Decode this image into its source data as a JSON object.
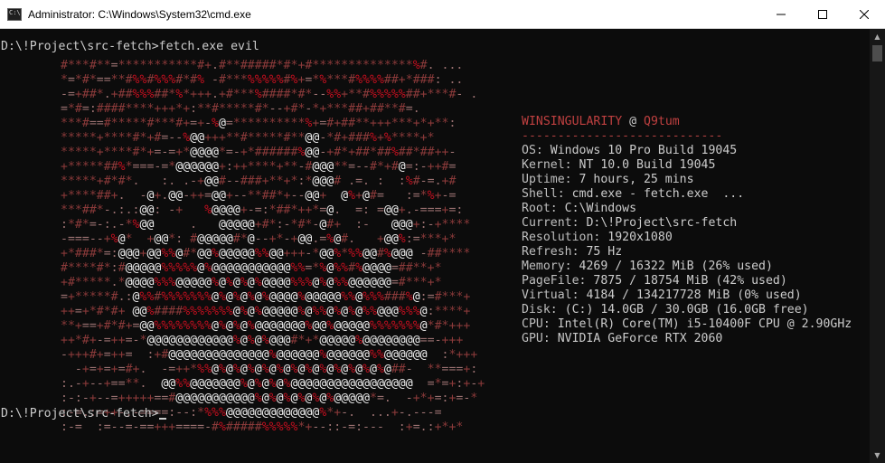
{
  "window": {
    "title": "Administrator: C:\\Windows\\System32\\cmd.exe",
    "icon": "cmd-icon"
  },
  "console": {
    "command_line": "D:\\!Project\\src-fetch>fetch.exe evil",
    "bottom_prompt": "D:\\!Project\\src-fetch>",
    "ascii_art": [
      "#***#**=***********#+.#**#####*#*+#**************%#. ...",
      "*=*#*==**#%%#%%%#*#% -#***%%%%%#%+=*%***#%%%%##+*###: ..",
      "-=+##*.+##%%%##*%*+++.+#***%####*#*--%%+**#%%%%%##+***#- .",
      "=*#=:####****+++*+:**#*****#*--+#*-*+***##+##**#=.",
      "***#==#*****#***#+=+-%@=**********%+=#+##**+++***+*+**:",
      "*****+****#*+#=--%@@+++**#*****#**@@-*#+###%+%****+*",
      "*****+****#*+=-=+*@@@@*=-+*######%@@-+#*+##*##%##*##++-",
      "+*****##%*===-=*@@@@@@+:++****+**-#@@@**=--#*+#@=:-++#=",
      "*****+#*#*.   :. .-+@@#--###+**+*:*@@@# .=. :  :%#-=.+#",
      "+****##+.  -@+.@@-++=@@+--**##*+--@@+  @%+@#=   :=*%+-=",
      "***##*-.:.:@@: -+   %@@@@+-=:*##*++*=@.  =: =@@+.-===+=:",
      ":*#*=-:.-*%@@     .   @@@@@+#*:-*#*-@#+  :-   @@@+:-+****",
      "-===--+%@*  +@@*: #@@@@@#*@--+*-+@@.=%@#.   +@@%:=***+*",
      "+*###*=:@@@+@@%%@#*@@%@@@@@%%@@+++-*@@%*%%@@#%@@@ -##****",
      "#****#*:#@@@@@%%%%%@%@@@@@@@@@@@%%=*%@%%#%@@@@=##**+*",
      "+#*****.*@@@@%%%@@@@@%@%@%@%@@@@%%%@%@%%@@@@@@=#***+*",
      "=+*****#.:@%%#%%%%%%%@%@%@%@%@@@@%@@@@@%%@%%%###%@:=#***+",
      "++=+*#*#+ @@%####%%%%%%%@%@%@@@@@%@%%@%@%@%%@@@%%%@:****+",
      "**+==+#*#+=@@%%%%%%%%@%@%@%@@@@@@@%@@%@@@@@%%%%%%%@*#*+++",
      "++*#+-=++=-*@@@@@@@@@@@@%@%@%@@@#*+*@@@@@%@@@@@@@@==-+++",
      "-+++#+=++=  :+#@@@@@@@@@@@@@@%@@@@@@%@@@@@@%%@@@@@@  :*+++",
      "  -+=+=+=#+.  -=++*%%@%@%@%@%@%@%@%@%@%@%@%@%@##-  **===+:",
      ":.-+--+==**.  @@%%@@@@@@@%@%@%@%@@@@@@@@@@@@@@@@@  =*=+:+-+",
      ":-:-+--=+++++==#@@@@@@@@@@@%@%@%@%@%@%@@@@@*=.  -+*+=:+=-*",
      ":-=.:=++-.-====:--:*%%%@@@@@@@@@@@@@%*+-.  ...+-.---=",
      ":-=  :=--=-==+++====-#%#####%%%%%*+--::-=:---  :+=.:+*+*"
    ],
    "sysinfo": {
      "user": "WINSINGULARITY",
      "at": "@",
      "host": "Q9tum",
      "separator": "----------------------------",
      "items": [
        {
          "label": "OS:",
          "value": "Windows 10 Pro Build 19045"
        },
        {
          "label": "Kernel:",
          "value": "NT 10.0 Build 19045"
        },
        {
          "label": "Uptime:",
          "value": "7 hours, 25 mins"
        },
        {
          "label": "Shell:",
          "value": "cmd.exe - fetch.exe  ..."
        },
        {
          "label": "Root:",
          "value": "C:\\Windows"
        },
        {
          "label": "Current:",
          "value": "D:\\!Project\\src-fetch"
        },
        {
          "label": "Resolution:",
          "value": "1920x1080"
        },
        {
          "label": "Refresh:",
          "value": "75 Hz"
        },
        {
          "label": "Memory:",
          "value": "4269 / 16322 MiB (26% used)"
        },
        {
          "label": "PageFile:",
          "value": "7875 / 18754 MiB (42% used)"
        },
        {
          "label": "Virtual:",
          "value": "4184 / 134217728 MiB (0% used)"
        },
        {
          "label": "Disk:",
          "value": "(C:) 14.0GB / 30.0GB (16.0GB free)"
        },
        {
          "label": "CPU:",
          "value": "Intel(R) Core(TM) i5-10400F CPU @ 2.90GHz"
        },
        {
          "label": "GPU:",
          "value": "NVIDIA GeForce RTX 2060"
        }
      ]
    }
  },
  "colors": {
    "background": "#0c0c0c",
    "text": "#cccccc",
    "art": "#8b3a3a",
    "header": "#c04040"
  }
}
